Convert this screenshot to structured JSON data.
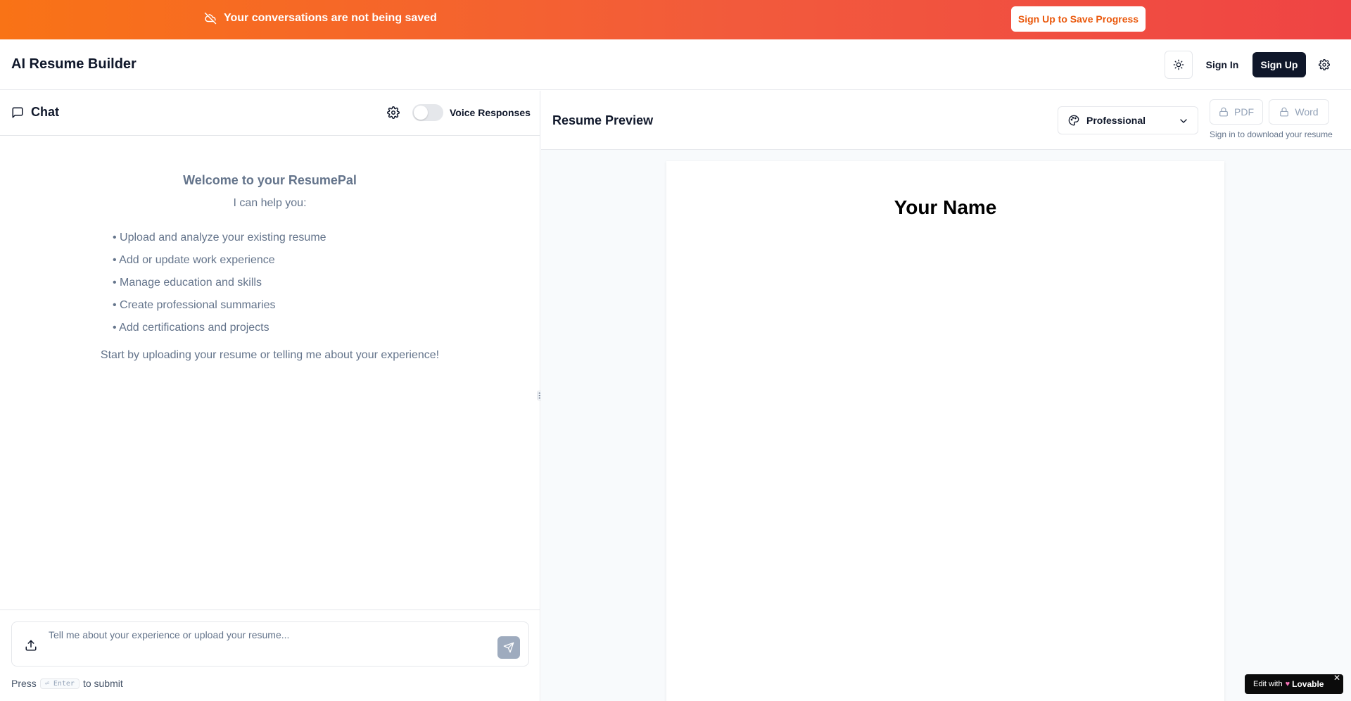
{
  "banner": {
    "message": "Your conversations are not being saved",
    "cta_label": "Sign Up to Save Progress",
    "gradient_from": "#f97316",
    "gradient_to": "#ef4444",
    "icon": "cloud-off-icon"
  },
  "header": {
    "app_title": "AI Resume Builder",
    "theme_icon": "sun-icon",
    "sign_in_label": "Sign In",
    "sign_up_label": "Sign Up",
    "settings_icon": "gear-icon"
  },
  "chat": {
    "title": "Chat",
    "title_icon": "message-square-icon",
    "settings_icon": "gear-icon",
    "voice_toggle_label": "Voice Responses",
    "voice_enabled": false,
    "welcome": {
      "title": "Welcome to your ResumePal",
      "subtitle": "I can help you:",
      "items": [
        "Upload and analyze your existing resume",
        "Add or update work experience",
        "Manage education and skills",
        "Create professional summaries",
        "Add certifications and projects"
      ],
      "cta": "Start by uploading your resume or telling me about your experience!"
    },
    "input": {
      "placeholder": "Tell me about your experience or upload your resume...",
      "upload_icon": "upload-icon",
      "send_icon": "send-icon"
    },
    "hint": {
      "prefix": "Press",
      "key": "⏎ Enter",
      "suffix": "to submit"
    }
  },
  "preview": {
    "title": "Resume Preview",
    "template": {
      "selected": "Professional",
      "icon": "palette-icon"
    },
    "download": {
      "pdf_label": "PDF",
      "word_label": "Word",
      "note": "Sign in to download your resume",
      "lock_icon": "lock-icon"
    },
    "document": {
      "name": "Your Name"
    }
  },
  "badge": {
    "prefix": "Edit with",
    "brand": "Lovable",
    "close": "✕"
  }
}
